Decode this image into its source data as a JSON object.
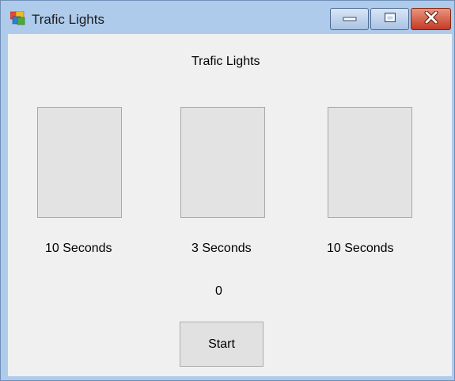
{
  "window": {
    "title": "Trafic Lights",
    "icon": "app-window-icon",
    "controls": [
      "minimize-icon",
      "maximize-icon",
      "close-icon"
    ]
  },
  "form": {
    "heading": "Trafic Lights",
    "lights": [
      {
        "duration": "10 Seconds"
      },
      {
        "duration": "3 Seconds"
      },
      {
        "duration": "10 Seconds"
      }
    ],
    "counter": "0",
    "start_label": "Start"
  },
  "colors": {
    "client_background": "#f0f0f0",
    "light_panel": "#e3e3e3",
    "close_button": "#c43a22"
  }
}
